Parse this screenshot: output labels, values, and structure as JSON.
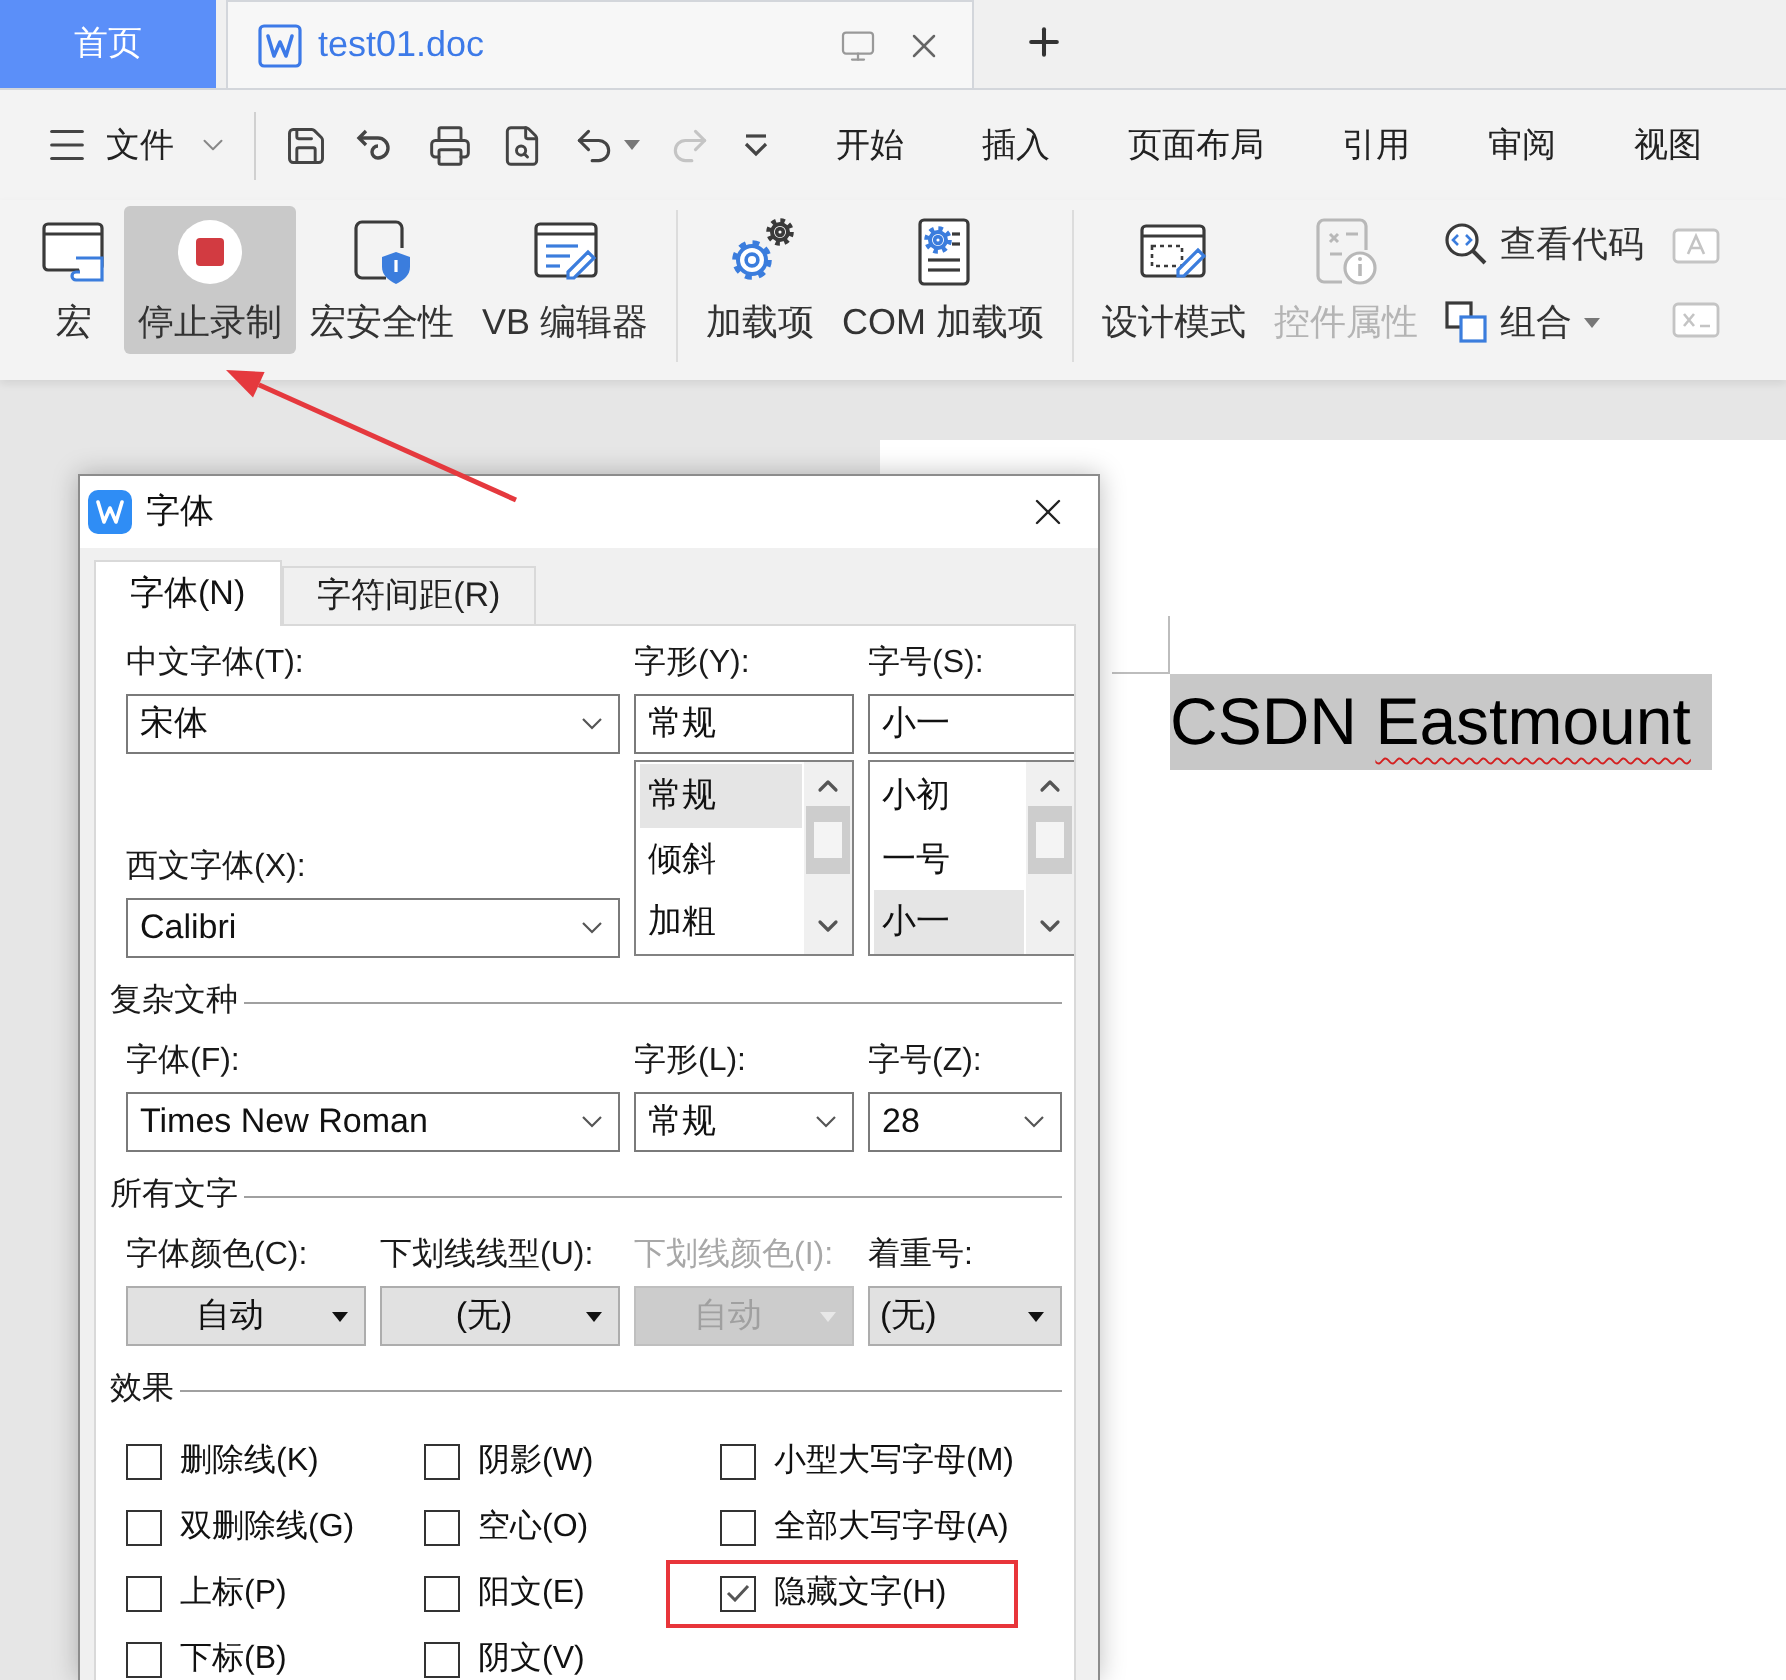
{
  "tabs": [
    {
      "kind": "home",
      "label": "首页",
      "selected": false
    },
    {
      "kind": "document",
      "label": "test01.doc",
      "selected": true
    }
  ],
  "menu": {
    "file": "文件",
    "quick_access": [
      {
        "disabled": false
      },
      {
        "disabled": false
      },
      {
        "disabled": false
      },
      {
        "disabled": false
      },
      {
        "disabled": false
      },
      {
        "disabled": true
      },
      {
        "disabled": false
      }
    ],
    "ribbon_tabs": [
      "开始",
      "插入",
      "页面布局",
      "引用",
      "审阅",
      "视图"
    ]
  },
  "toolbar": {
    "groups": [
      {
        "items": [
          {
            "label": "宏",
            "active": false,
            "disabled": false,
            "pointed_at": false
          },
          {
            "label": "停止录制",
            "active": true,
            "disabled": false,
            "pointed_at": true
          },
          {
            "label": "宏安全性",
            "active": false,
            "disabled": false,
            "pointed_at": false
          },
          {
            "label": "VB 编辑器",
            "active": false,
            "disabled": false,
            "pointed_at": false
          }
        ]
      },
      {
        "items": [
          {
            "label": "加载项",
            "active": false,
            "disabled": false,
            "pointed_at": false
          },
          {
            "label": "COM 加载项",
            "active": false,
            "disabled": false,
            "pointed_at": false
          }
        ]
      },
      {
        "items": [
          {
            "label": "设计模式",
            "active": false,
            "disabled": false,
            "pointed_at": false
          },
          {
            "label": "控件属性",
            "active": false,
            "disabled": true,
            "pointed_at": false
          }
        ],
        "stack": [
          {
            "label": "查看代码",
            "dropdown": false
          },
          {
            "label": "组合",
            "dropdown": true
          }
        ]
      }
    ]
  },
  "document": {
    "selected": true,
    "words": [
      {
        "text": "CSDN",
        "misspelled": false
      },
      {
        "text": "Eastmount",
        "misspelled": true
      }
    ]
  },
  "dialog": {
    "title": "字体",
    "tabs": [
      {
        "label": "字体(N)",
        "selected": true
      },
      {
        "label": "字符间距(R)",
        "selected": false
      }
    ],
    "chinese_font": {
      "label": "中文字体(T):",
      "value": "宋体"
    },
    "western_font": {
      "label": "西文字体(X):",
      "value": "Calibri"
    },
    "style": {
      "label": "字形(Y):",
      "value": "常规",
      "options": [
        {
          "label": "常规",
          "selected": true
        },
        {
          "label": "倾斜",
          "selected": false
        },
        {
          "label": "加粗",
          "selected": false
        }
      ]
    },
    "size": {
      "label": "字号(S):",
      "value": "小一",
      "options": [
        {
          "label": "小初",
          "selected": false
        },
        {
          "label": "一号",
          "selected": false
        },
        {
          "label": "小一",
          "selected": true
        }
      ]
    },
    "complex_script": {
      "heading": "复杂文种",
      "fields": [
        {
          "label": "字体(F):",
          "value": "Times New Roman"
        },
        {
          "label": "字形(L):",
          "value": "常规"
        },
        {
          "label": "字号(Z):",
          "value": "28"
        }
      ]
    },
    "all_text": {
      "heading": "所有文字",
      "fields": [
        {
          "label": "字体颜色(C):",
          "value": "自动",
          "kind": "button",
          "disabled": false
        },
        {
          "label": "下划线线型(U):",
          "value": "(无)",
          "kind": "button",
          "disabled": false
        },
        {
          "label": "下划线颜色(I):",
          "value": "自动",
          "kind": "button",
          "disabled": true
        },
        {
          "label": "着重号:",
          "value": "(无)",
          "kind": "list",
          "disabled": false
        }
      ]
    },
    "effects": {
      "heading": "效果",
      "options": [
        {
          "label": "删除线(K)",
          "checked": false,
          "highlighted": false
        },
        {
          "label": "阴影(W)",
          "checked": false,
          "highlighted": false
        },
        {
          "label": "小型大写字母(M)",
          "checked": false,
          "highlighted": false
        },
        {
          "label": "双删除线(G)",
          "checked": false,
          "highlighted": false
        },
        {
          "label": "空心(O)",
          "checked": false,
          "highlighted": false
        },
        {
          "label": "全部大写字母(A)",
          "checked": false,
          "highlighted": false
        },
        {
          "label": "上标(P)",
          "checked": false,
          "highlighted": false
        },
        {
          "label": "阳文(E)",
          "checked": false,
          "highlighted": false
        },
        {
          "label": "隐藏文字(H)",
          "checked": true,
          "highlighted": true
        },
        {
          "label": "下标(B)",
          "checked": false,
          "highlighted": false
        },
        {
          "label": "阴文(V)",
          "checked": false,
          "highlighted": false
        }
      ]
    }
  }
}
